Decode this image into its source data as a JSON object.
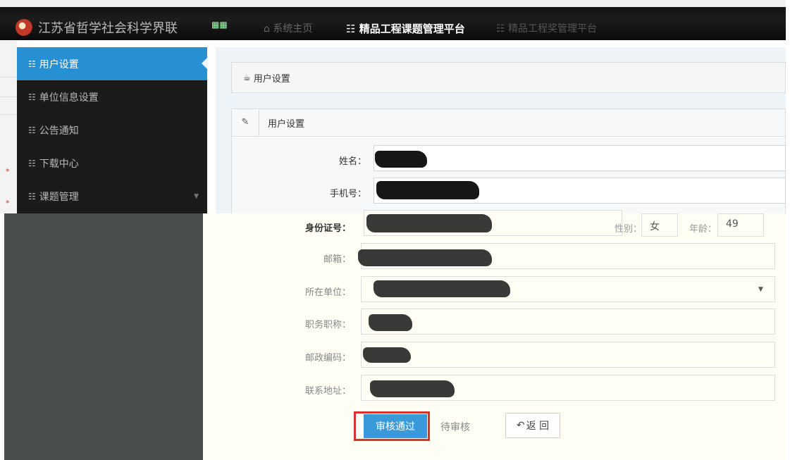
{
  "header": {
    "org_title": "江苏省哲学社会科学界联",
    "nav": {
      "home": "系统主页",
      "active": "精品工程课题管理平台",
      "award": "精品工程奖管理平台"
    }
  },
  "sidebar": {
    "items": [
      {
        "label": "用户设置"
      },
      {
        "label": "单位信息设置"
      },
      {
        "label": "公告通知"
      },
      {
        "label": "下载中心"
      },
      {
        "label": "课题管理"
      }
    ]
  },
  "breadcrumb": {
    "label": "用户设置"
  },
  "panel": {
    "title": "用户设置"
  },
  "form": {
    "name_label": "姓名：",
    "phone_label": "手机号：",
    "id_label": "身份证号：",
    "gender_label": "性别：",
    "gender_value": "女",
    "age_label": "年龄：",
    "age_value": "49",
    "email_label": "邮箱：",
    "unit_label": "所在单位：",
    "title_label": "职务职称：",
    "postcode_label": "邮政编码：",
    "address_label": "联系地址："
  },
  "actions": {
    "approve": "审核通过",
    "pending": "待审核",
    "back": "返 回"
  }
}
